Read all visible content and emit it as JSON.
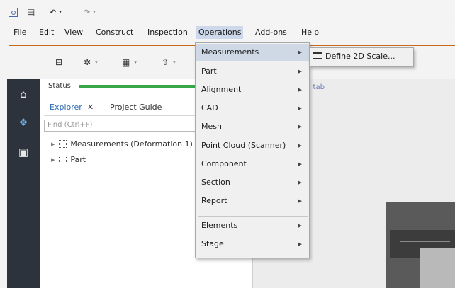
{
  "menubar": {
    "items": [
      "File",
      "Edit",
      "View",
      "Construct",
      "Inspection",
      "Operations",
      "Add-ons",
      "Help"
    ],
    "active_index": 5
  },
  "explorer": {
    "status_label": "Status",
    "tabs": [
      "Explorer",
      "Project Guide"
    ],
    "find_placeholder": "Find (Ctrl+F)",
    "tree": [
      "Measurements (Deformation 1)",
      "Part"
    ]
  },
  "workspace_tab_text": "n tab",
  "operations_menu": {
    "items": [
      {
        "label": "Measurements",
        "has_sub": true
      },
      {
        "label": "Part",
        "has_sub": true
      },
      {
        "label": "Alignment",
        "has_sub": true
      },
      {
        "label": "CAD",
        "has_sub": true
      },
      {
        "label": "Mesh",
        "has_sub": true
      },
      {
        "label": "Point Cloud (Scanner)",
        "has_sub": true
      },
      {
        "label": "Component",
        "has_sub": true
      },
      {
        "label": "Section",
        "has_sub": true
      },
      {
        "label": "Report",
        "has_sub": true
      },
      {
        "label": "Elements",
        "has_sub": true
      },
      {
        "label": "Stage",
        "has_sub": true
      }
    ],
    "highlighted": "Measurements"
  },
  "measurements_submenu": {
    "items": [
      "Define 2D Scale..."
    ]
  },
  "colors": {
    "accent_line": "#c9691a",
    "status_green": "#36a847",
    "rail_bg": "#2d333c",
    "menu_highlight": "#cfd9e6"
  },
  "icons": {
    "rail": [
      "home-icon",
      "explorer-icon",
      "document-icon"
    ]
  }
}
